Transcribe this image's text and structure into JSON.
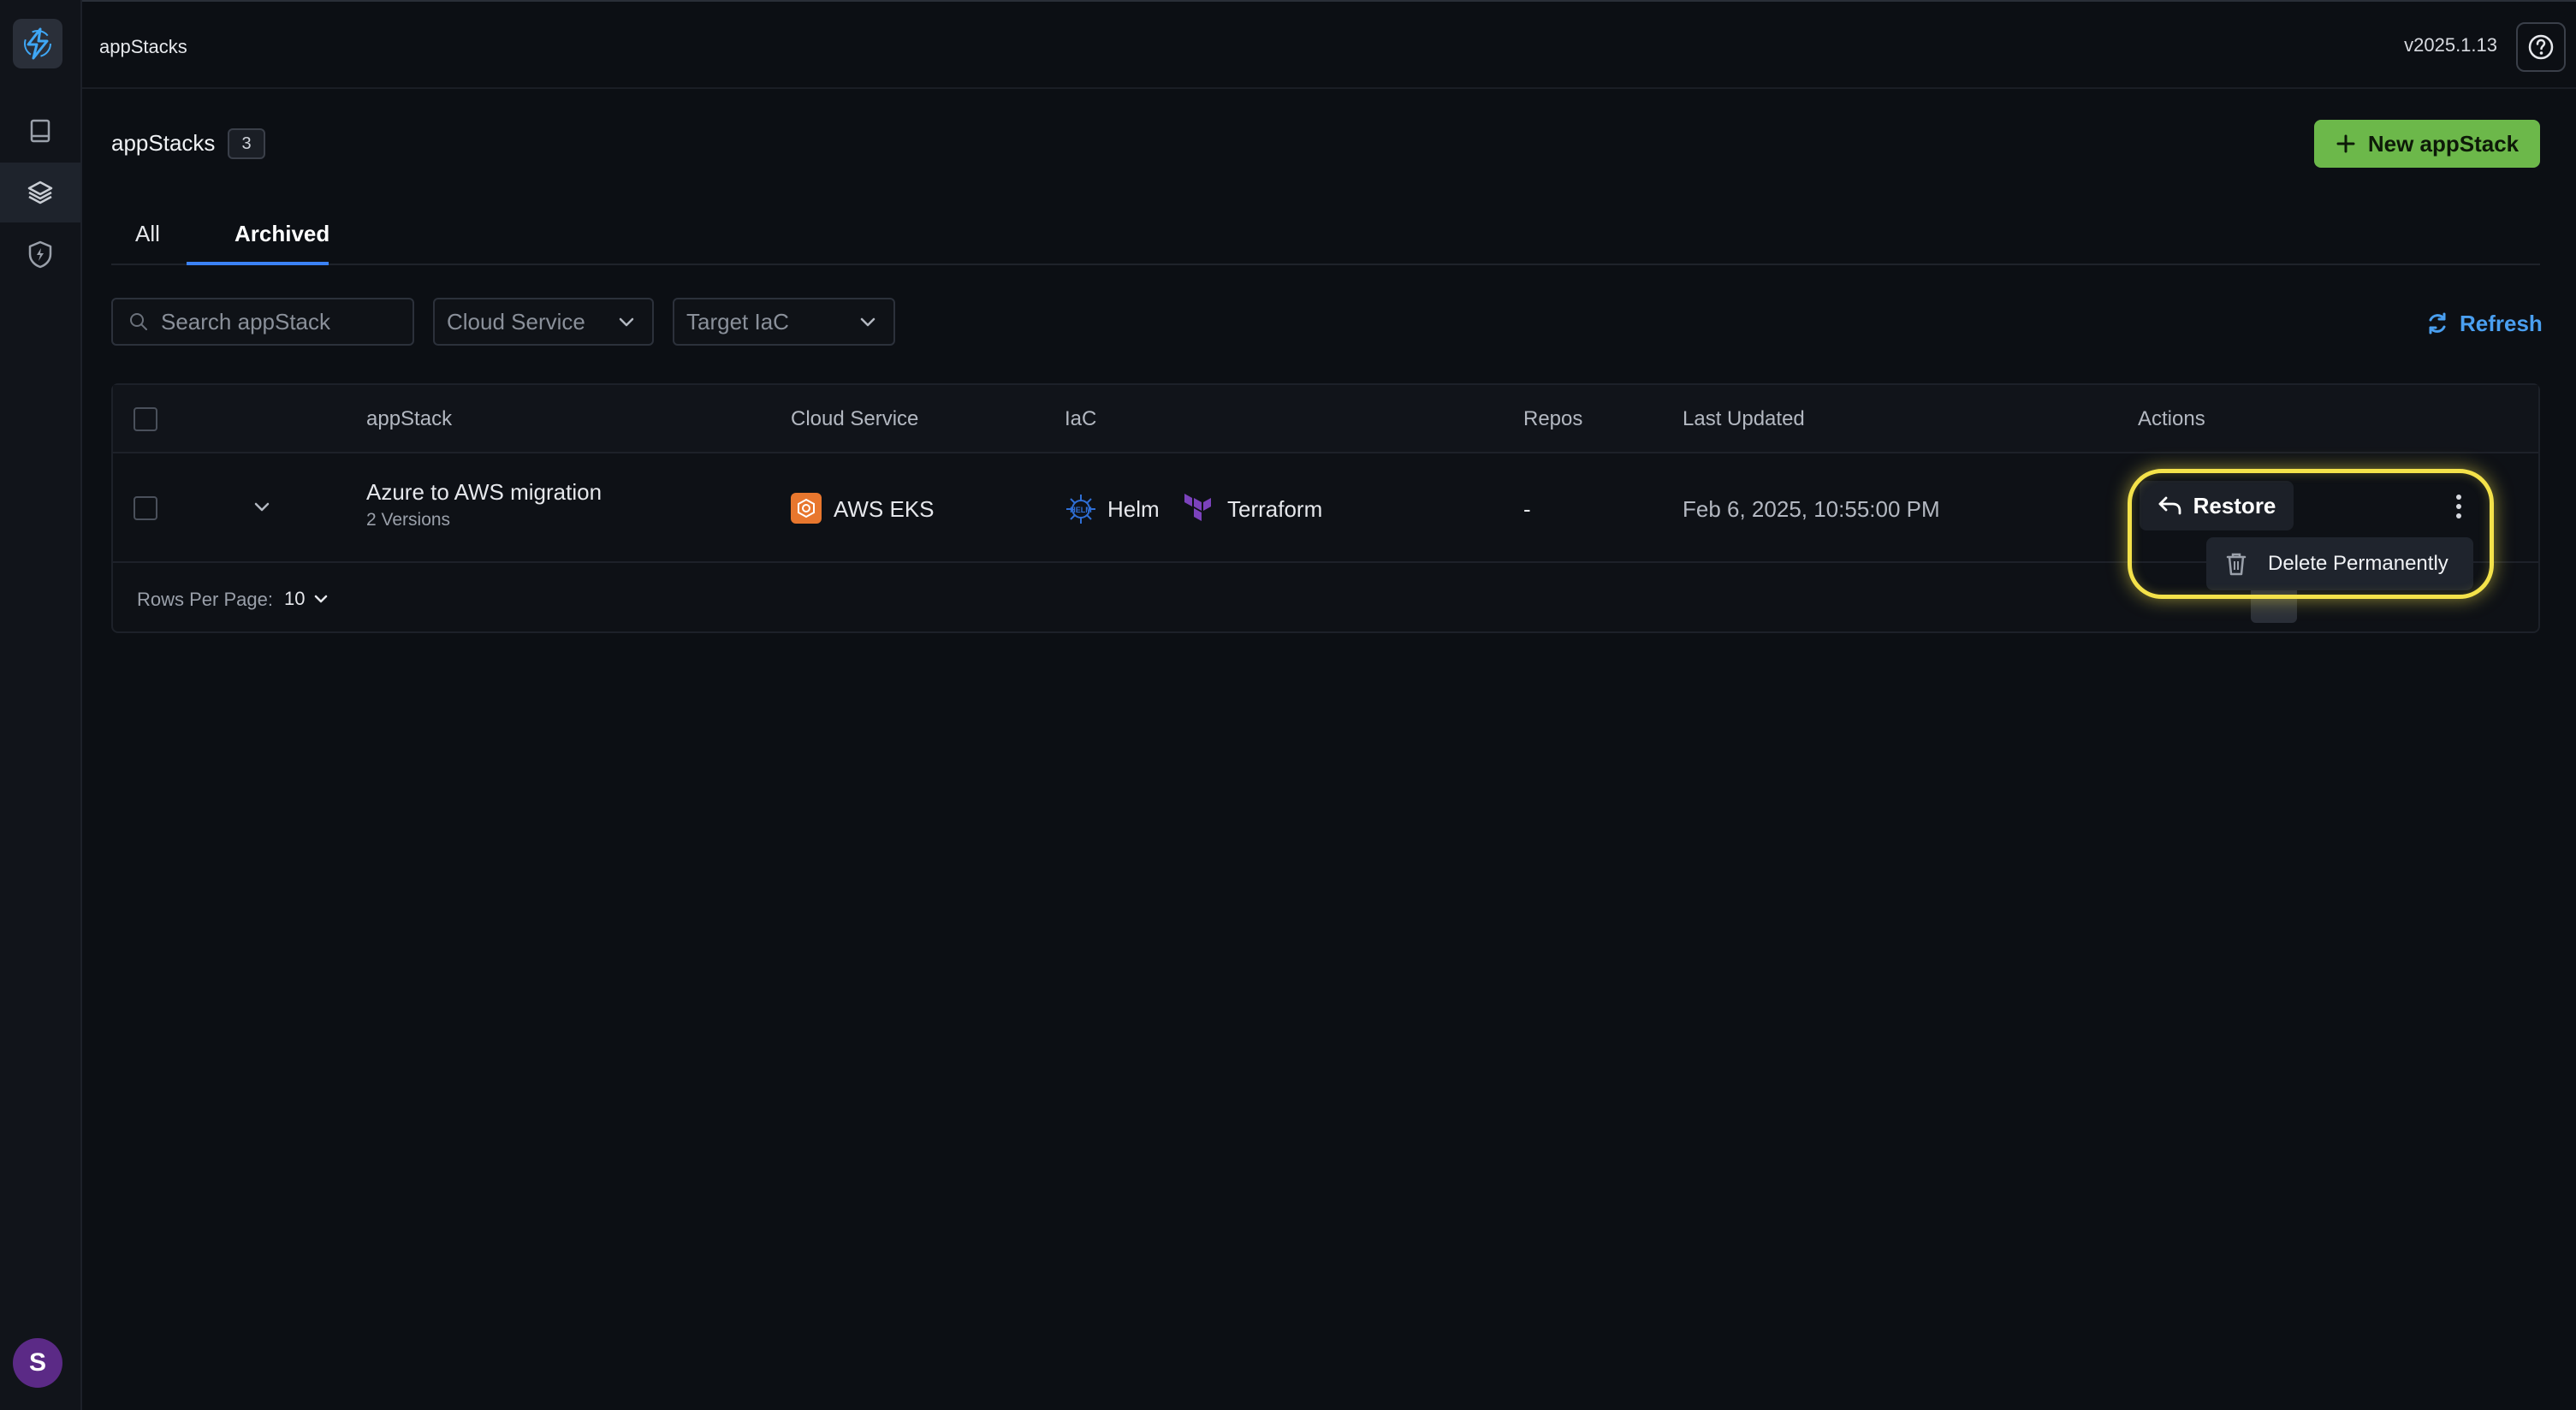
{
  "topbar": {
    "title": "appStacks",
    "version": "v2025.1.13"
  },
  "sidebar": {
    "items": [
      {
        "icon": "book-icon"
      },
      {
        "icon": "layers-icon"
      },
      {
        "icon": "shield-bolt-icon"
      }
    ],
    "avatar_initial": "S"
  },
  "header": {
    "title": "appStacks",
    "count": "3",
    "new_button": "New appStack"
  },
  "tabs": [
    {
      "label": "All"
    },
    {
      "label": "Archived"
    }
  ],
  "filters": {
    "search_placeholder": "Search appStack",
    "cloud_service": "Cloud Service",
    "target_iac": "Target IaC",
    "refresh": "Refresh"
  },
  "table": {
    "columns": [
      "appStack",
      "Cloud Service",
      "IaC",
      "Repos",
      "Last Updated",
      "Actions"
    ],
    "rows": [
      {
        "name": "Azure to AWS migration",
        "versions": "2 Versions",
        "cloud_service": "AWS EKS",
        "iac": [
          "Helm",
          "Terraform"
        ],
        "repos": "-",
        "last_updated": "Feb 6, 2025, 10:55:00 PM",
        "action": "Restore"
      }
    ],
    "rows_per_page_label": "Rows Per Page:",
    "rows_per_page": "10"
  },
  "menu": {
    "delete": "Delete Permanently"
  },
  "colors": {
    "accent_green": "#6cb84a",
    "link_blue": "#4a9ff0",
    "tab_underline": "#3b82f6",
    "highlight": "#f4e24a"
  }
}
